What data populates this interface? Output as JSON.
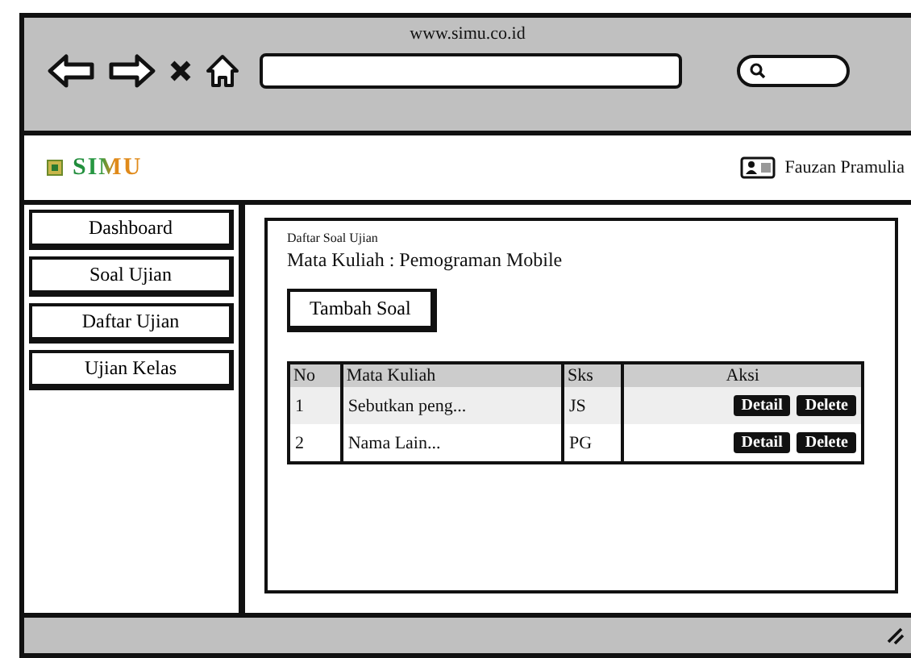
{
  "window": {
    "url": "www.simu.co.id"
  },
  "header": {
    "logo": "SIMU",
    "user": "Fauzan Pramulia"
  },
  "sidebar": {
    "items": [
      {
        "label": "Dashboard"
      },
      {
        "label": "Soal Ujian"
      },
      {
        "label": "Daftar Ujian"
      },
      {
        "label": "Ujian Kelas"
      }
    ]
  },
  "content": {
    "breadcrumb": "Daftar Soal Ujian",
    "title": "Mata Kuliah : Pemograman Mobile",
    "add_button": "Tambah Soal",
    "table": {
      "columns": [
        "No",
        "Mata Kuliah",
        "Sks",
        "Aksi"
      ],
      "rows": [
        {
          "no": "1",
          "mata_kuliah": "Sebutkan peng...",
          "sks": "JS",
          "actions": [
            "Detail",
            "Delete"
          ]
        },
        {
          "no": "2",
          "mata_kuliah": "Nama Lain...",
          "sks": "PG",
          "actions": [
            "Detail",
            "Delete"
          ]
        }
      ]
    }
  }
}
